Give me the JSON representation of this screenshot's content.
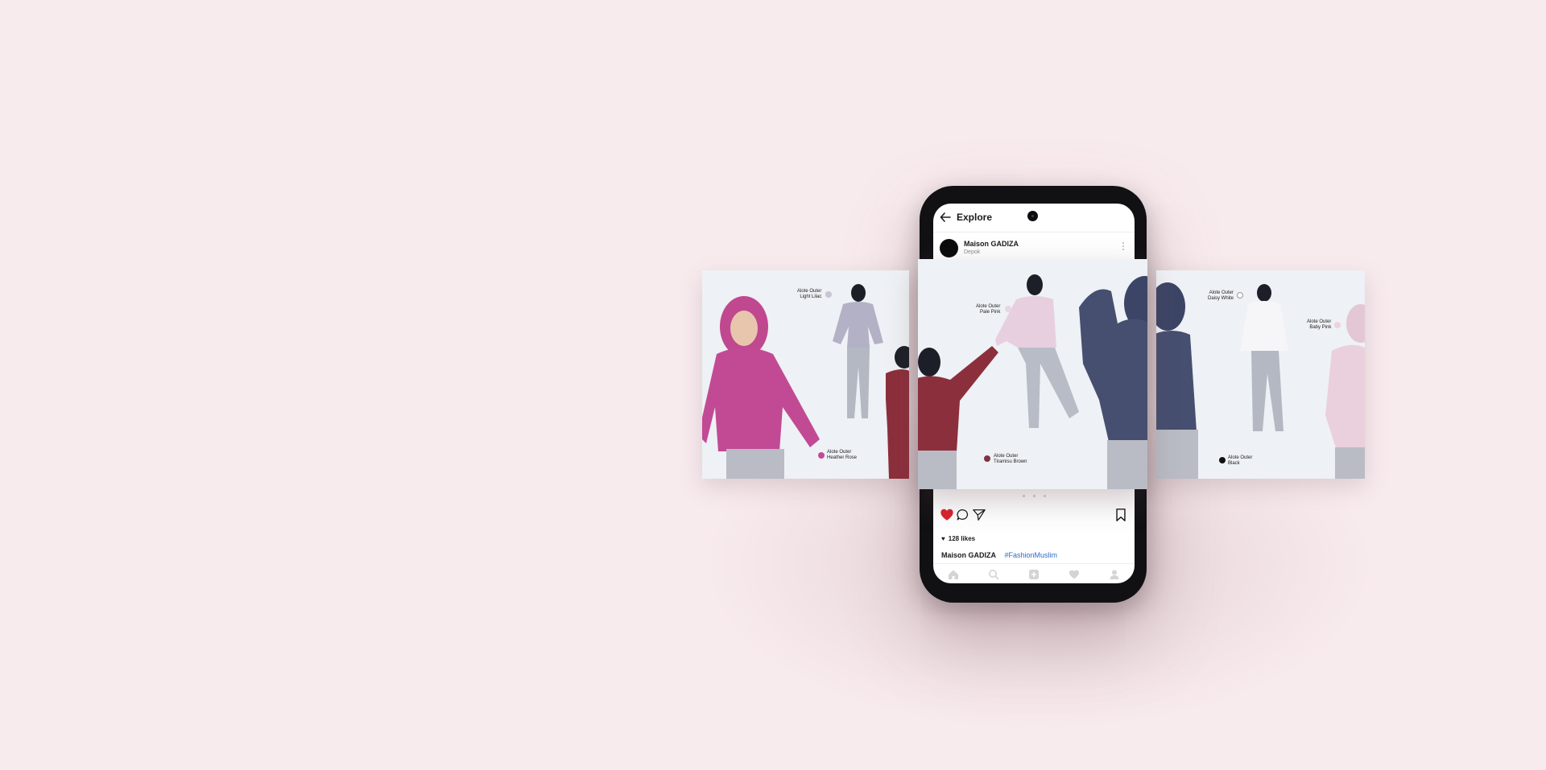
{
  "screen": {
    "title": "Explore"
  },
  "post": {
    "account_name": "Maison GADIZA",
    "location": "Depok",
    "likes": "128 likes",
    "caption_user": "Maison GADIZA",
    "hashtag": "#FashionMuslim",
    "carousel_dots": 3,
    "liked": true
  },
  "icons": {
    "back": "arrow-left-icon",
    "more": "more-vertical-icon",
    "like": "heart-icon",
    "comment": "comment-icon",
    "share": "send-icon",
    "save": "bookmark-icon",
    "nav": [
      "home-icon",
      "search-icon",
      "add-icon",
      "activity-heart-icon",
      "profile-icon"
    ]
  },
  "cards": {
    "left": [
      {
        "line1": "Alote Outer",
        "line2": "Light Lilac",
        "swatch": "#b9b6c8"
      },
      {
        "line1": "Alote Outer",
        "line2": "Heather Rose",
        "swatch": "#c24a94"
      }
    ],
    "middle": [
      {
        "line1": "Alote Outer",
        "line2": "Pale Pink",
        "swatch": "#e9d6e0"
      },
      {
        "line1": "Alote Outer",
        "line2": "Tiramisu Brown",
        "swatch": "#7f3240"
      }
    ],
    "right": [
      {
        "line1": "Alote Outer",
        "line2": "Daisy White",
        "swatch": "#ffffff"
      },
      {
        "line1": "Alote Outer",
        "line2": "Baby Pink",
        "swatch": "#efd2dc"
      },
      {
        "line1": "Alote Outer",
        "line2": "Black",
        "swatch": "#111111"
      }
    ]
  },
  "colors": {
    "background": "#f8ebee",
    "like_red": "#d9232e",
    "hashtag_blue": "#2d6bc8",
    "phone_body": "#111114"
  }
}
